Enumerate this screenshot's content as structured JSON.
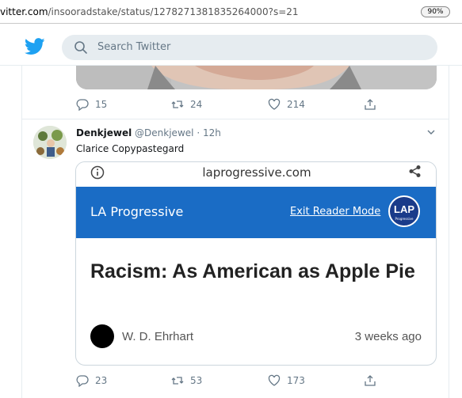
{
  "browser": {
    "url_prefix": "vitter.com",
    "url_path": "/insooradstake/status/1278271381835264000?s=21",
    "zoom": "90%"
  },
  "twitter": {
    "search_placeholder": "Search Twitter"
  },
  "previous_tweet": {
    "replies": "15",
    "retweets": "24",
    "likes": "214"
  },
  "tweet": {
    "display_name": "Denkjewel",
    "handle": "@Denkjewel",
    "separator": "·",
    "time": "12h",
    "text": "Clarice Copypastegard",
    "replies": "23",
    "retweets": "53",
    "likes": "173",
    "card": {
      "domain": "laprogressive.com",
      "site_name": "LA Progressive",
      "exit_label": "Exit Reader Mode",
      "logo_text": "LAP",
      "logo_subtext": "Progressive",
      "headline": "Racism: As American as Apple Pie",
      "author": "W. D. Ehrhart",
      "age": "3 weeks ago"
    }
  },
  "colors": {
    "twitter_blue": "#1da1f2",
    "banner_blue": "#1a6cc5",
    "muted": "#657786"
  }
}
